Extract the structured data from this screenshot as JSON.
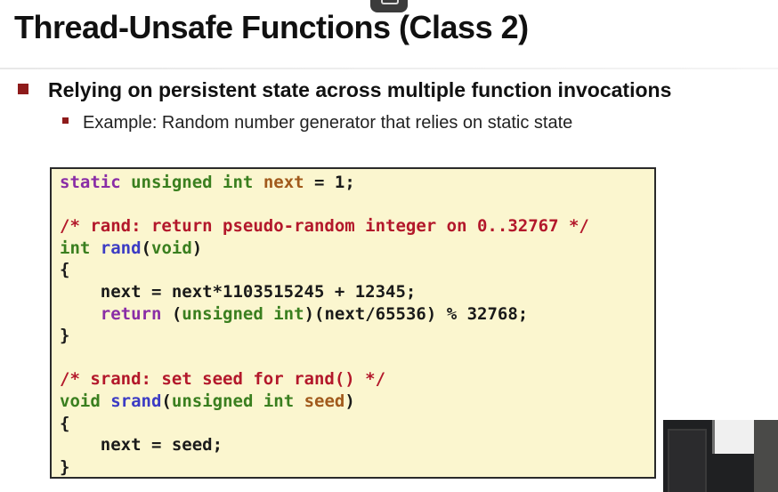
{
  "slide": {
    "title": "Thread-Unsafe Functions (Class 2)",
    "bullet_main": "Relying on persistent state across multiple function invocations",
    "bullet_sub": "Example: Random number generator that relies on static state"
  },
  "code": {
    "l1": {
      "kw": "static",
      "ty": "unsigned int",
      "var": "next",
      "rest": " = 1;"
    },
    "l3": {
      "comment": "/* rand: return pseudo-random integer on 0..32767 */"
    },
    "l4": {
      "ty": "int",
      "fn": "rand",
      "open": "(",
      "arg": "void",
      "close": ")"
    },
    "l5": "{",
    "l6": "    next = next*1103515245 + 12345;",
    "l7": {
      "indent": "    ",
      "kw": "return",
      "open": " (",
      "ty": "unsigned int",
      "rest": ")(next/65536) % 32768;"
    },
    "l8": "}",
    "l10": {
      "comment": "/* srand: set seed for rand() */"
    },
    "l11": {
      "ty": "void",
      "fn": "srand",
      "open": "(",
      "ty2": "unsigned int",
      "arg": "seed",
      "close": ")"
    },
    "l12": "{",
    "l13": "    next = seed;",
    "l14": "}"
  },
  "colors": {
    "bullet": "#8e1b1b",
    "code_background": "#fbf6cf",
    "keyword": "#8a2da6",
    "type": "#3a7f1f",
    "comment": "#b3182b",
    "function": "#3c3cc4",
    "identifier": "#a15a1c"
  },
  "icons": {
    "top_tab": "minimize-tab-icon"
  }
}
